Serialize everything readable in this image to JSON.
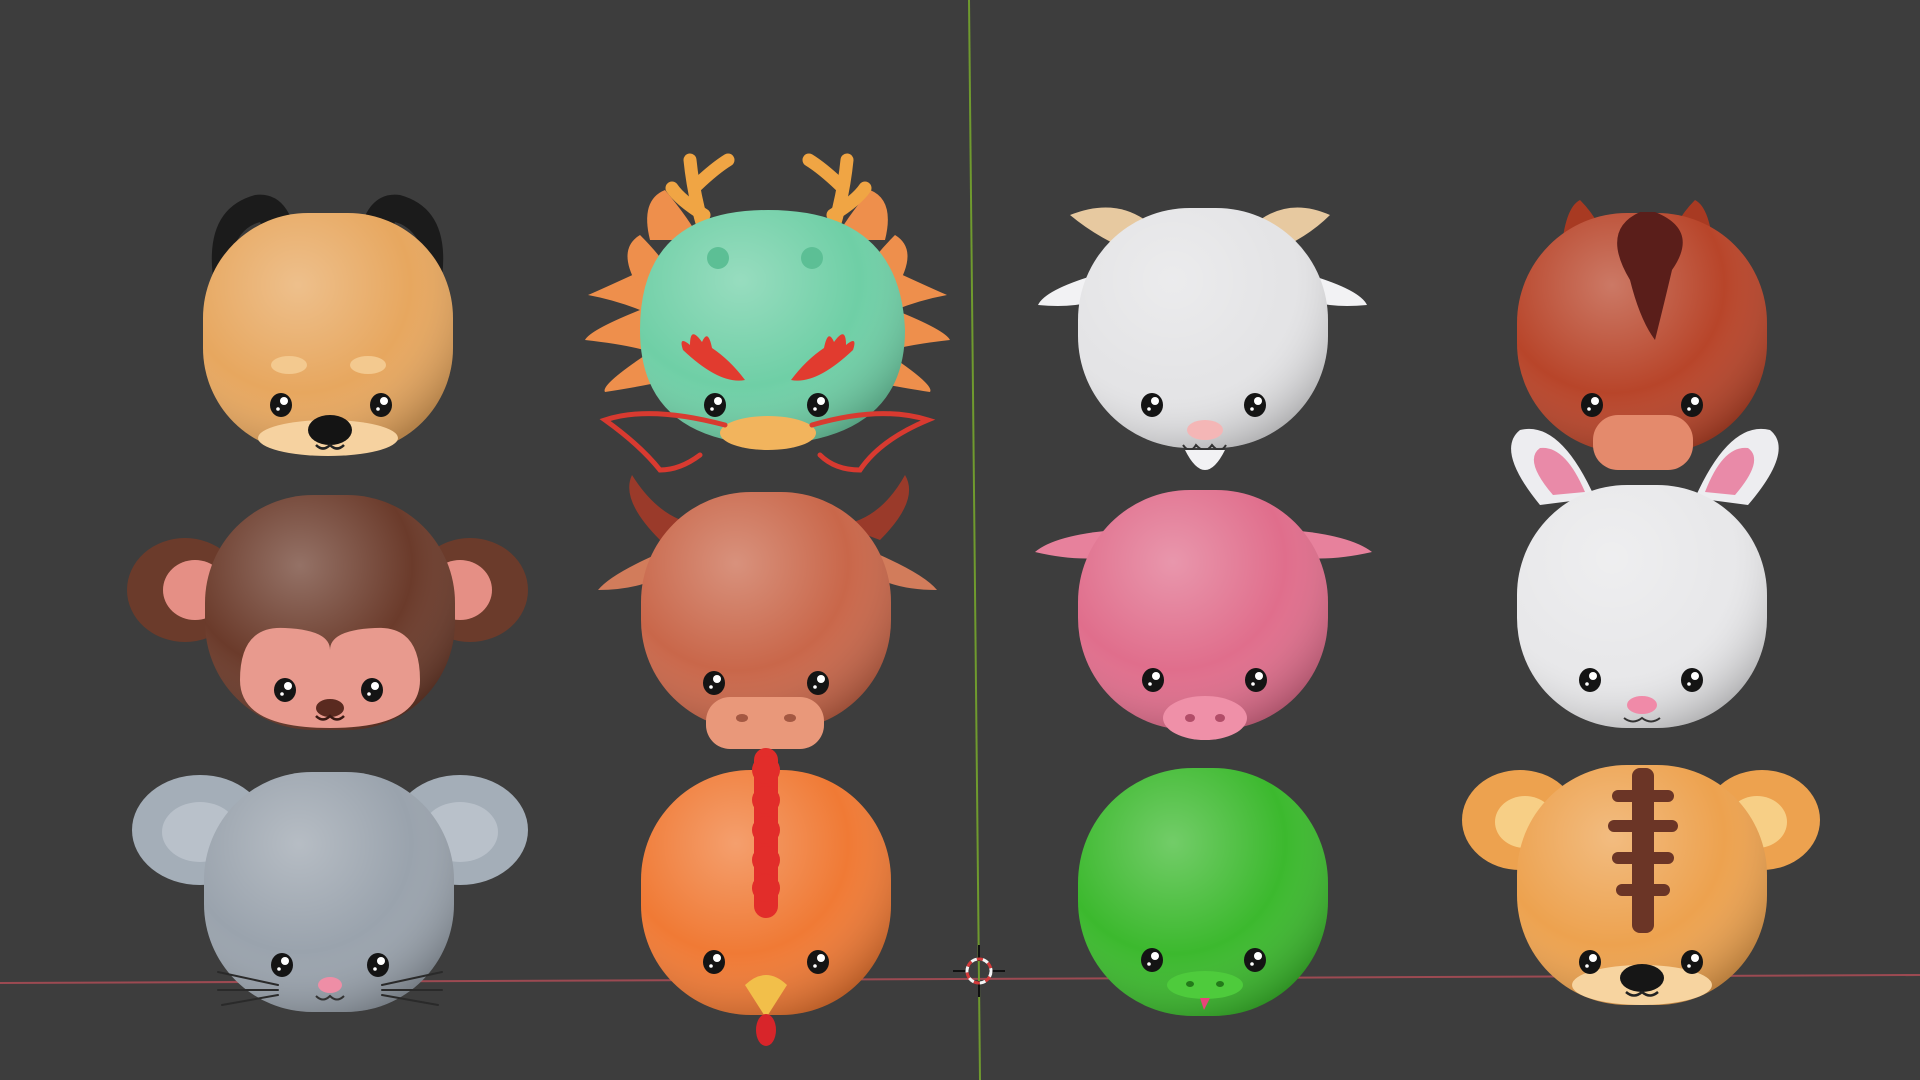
{
  "viewport": {
    "background": "#3d3d3d",
    "axis_x_color": "#9c4a52",
    "axis_y_color": "#6f9a2e",
    "cursor_icon": "3d-cursor-icon"
  },
  "models": [
    {
      "id": "dog",
      "icon": "dog-head-icon",
      "color": "#e7a75f"
    },
    {
      "id": "dragon",
      "icon": "dragon-head-icon",
      "color": "#6fcfa6"
    },
    {
      "id": "goat",
      "icon": "goat-head-icon",
      "color": "#e4e4e6"
    },
    {
      "id": "horse",
      "icon": "horse-head-icon",
      "color": "#b8452a"
    },
    {
      "id": "monkey",
      "icon": "monkey-head-icon",
      "color": "#6b3b2b"
    },
    {
      "id": "ox",
      "icon": "ox-head-icon",
      "color": "#c9674a"
    },
    {
      "id": "pig",
      "icon": "pig-head-icon",
      "color": "#e06e8c"
    },
    {
      "id": "rabbit",
      "icon": "rabbit-head-icon",
      "color": "#e8e8ea"
    },
    {
      "id": "rat",
      "icon": "rat-head-icon",
      "color": "#9aa3ad"
    },
    {
      "id": "rooster",
      "icon": "rooster-head-icon",
      "color": "#f07a35"
    },
    {
      "id": "snake",
      "icon": "snake-head-icon",
      "color": "#3cb92e"
    },
    {
      "id": "tiger",
      "icon": "tiger-head-icon",
      "color": "#eda24f"
    }
  ]
}
